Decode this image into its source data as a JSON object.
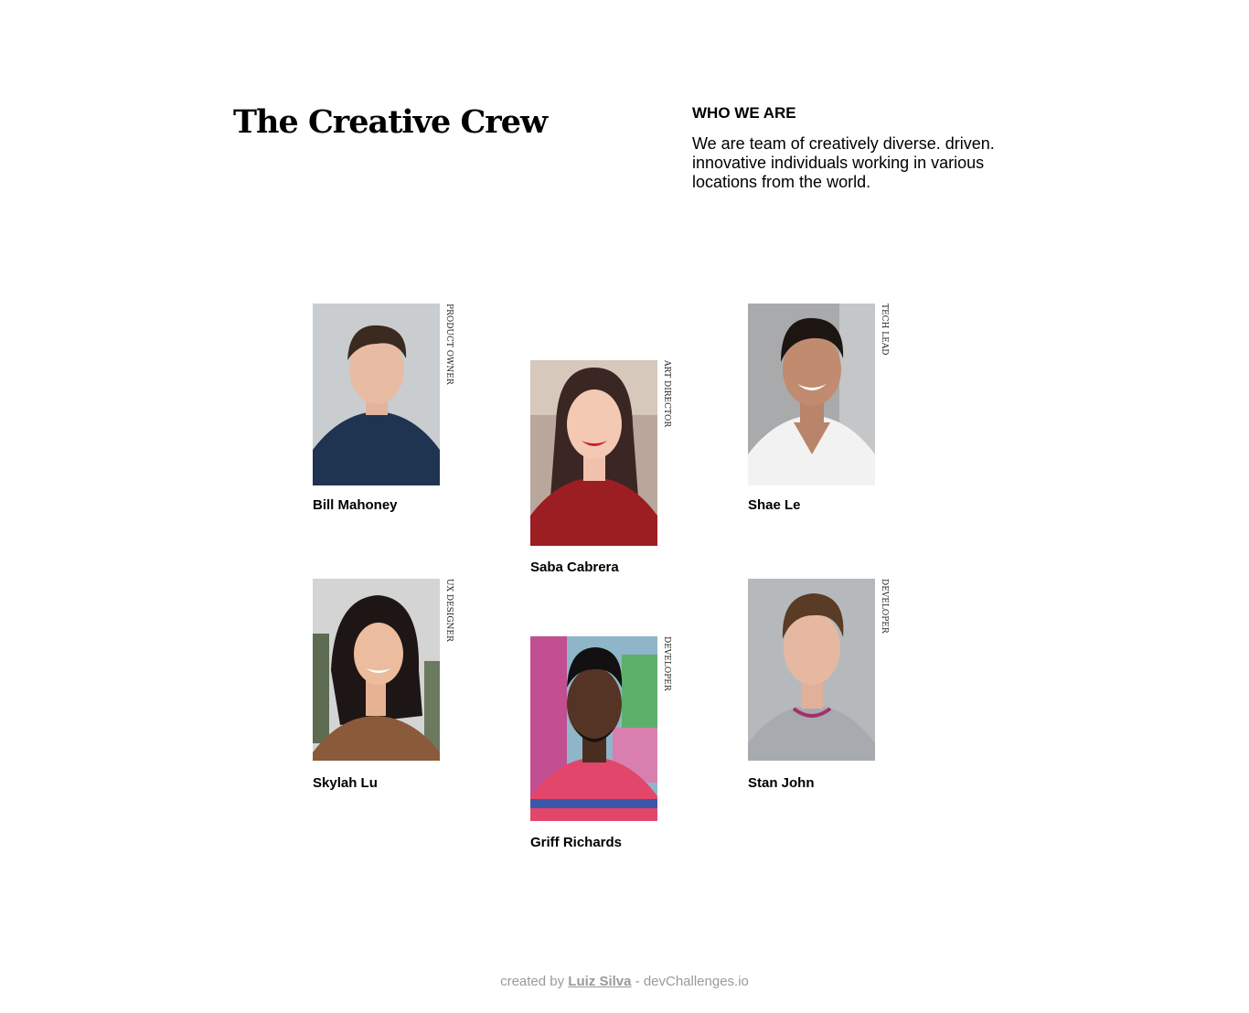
{
  "header": {
    "title": "The Creative Crew",
    "who_heading": "WHO WE ARE",
    "who_text": "We are team of creatively diverse. driven. innovative individuals working in various locations from the world."
  },
  "members": [
    {
      "name": "Bill Mahoney",
      "role": "PRODUCT OWNER"
    },
    {
      "name": "Saba Cabrera",
      "role": "ART DIRECTOR"
    },
    {
      "name": "Shae Le",
      "role": "TECH LEAD"
    },
    {
      "name": "Skylah Lu",
      "role": "UX DESIGNER"
    },
    {
      "name": "Griff Richards",
      "role": "DEVELOPER"
    },
    {
      "name": "Stan John",
      "role": "DEVELOPER"
    }
  ],
  "footer": {
    "prefix": "created by",
    "author": "Luiz Silva",
    "suffix": "- devChallenges.io"
  }
}
